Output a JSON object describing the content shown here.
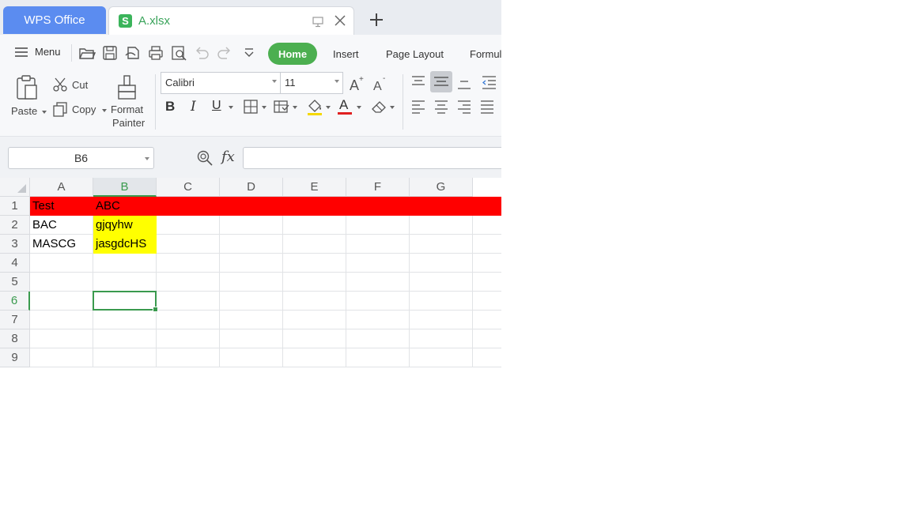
{
  "tabs": {
    "app_tab": "WPS Office",
    "file_tab": "A.xlsx",
    "file_icon_letter": "S"
  },
  "toolbar": {
    "menu_label": "Menu",
    "ribbon_tabs": [
      "Home",
      "Insert",
      "Page Layout",
      "Formul"
    ]
  },
  "ribbon": {
    "paste_label": "Paste",
    "cut_label": "Cut",
    "copy_label": "Copy",
    "format_painter_label_1": "Format",
    "format_painter_label_2": "Painter",
    "font_name": "Calibri",
    "font_size": "11",
    "bold_glyph": "B",
    "italic_glyph": "I",
    "underline_glyph": "U",
    "font_color_glyph": "A",
    "font_color": "#e02020",
    "fill_color": "#f5d800"
  },
  "formula_bar": {
    "name_box": "B6",
    "fx_label": "fx",
    "formula": ""
  },
  "sheet": {
    "columns": [
      "A",
      "B",
      "C",
      "D",
      "E",
      "F",
      "G"
    ],
    "rows": [
      "1",
      "2",
      "3",
      "4",
      "5",
      "6",
      "7",
      "8",
      "9"
    ],
    "active_column": "B",
    "active_row": "6",
    "cells": {
      "A1": "Test",
      "B1": "ABC",
      "A2": "BAC",
      "B2": "gjqyhw",
      "A3": "MASCG",
      "B3": "jasgdcHS"
    },
    "fills": {
      "row1": "#ff0000",
      "B2": "#ffff00",
      "B3": "#ffff00"
    }
  }
}
